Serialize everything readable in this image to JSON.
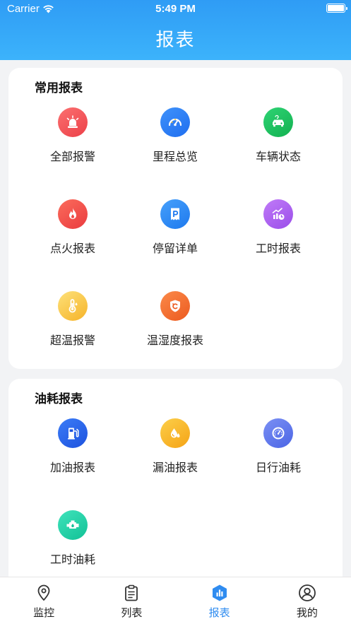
{
  "status_bar": {
    "carrier": "Carrier",
    "time": "5:49 PM"
  },
  "header": {
    "title": "报表"
  },
  "sections": [
    {
      "title": "常用报表",
      "items": [
        {
          "label": "全部报警",
          "icon": "alarm-light-icon",
          "color": "#f2555a"
        },
        {
          "label": "里程总览",
          "icon": "speedometer-icon",
          "color": "#2b7ff6"
        },
        {
          "label": "车辆状态",
          "icon": "car-icon",
          "color": "#19c25f"
        },
        {
          "label": "点火报表",
          "icon": "flame-icon",
          "color": "#f2524f"
        },
        {
          "label": "停留详单",
          "icon": "parking-icon",
          "color": "#2f8cf5"
        },
        {
          "label": "工时报表",
          "icon": "work-hours-chart-icon",
          "color": "#a95ef0"
        },
        {
          "label": "超温报警",
          "icon": "thermometer-icon",
          "color": "#f8c33a"
        },
        {
          "label": "温湿度报表",
          "icon": "temp-humidity-shield-icon",
          "color": "#f26a2e"
        }
      ]
    },
    {
      "title": "油耗报表",
      "items": [
        {
          "label": "加油报表",
          "icon": "fuel-pump-icon",
          "color": "#2f6ef2"
        },
        {
          "label": "漏油报表",
          "icon": "oil-drop-icon",
          "color": "#f8b425"
        },
        {
          "label": "日行油耗",
          "icon": "gauge-icon",
          "color": "#5a78ef"
        },
        {
          "label": "工时油耗",
          "icon": "engine-icon",
          "color": "#1fd1a8"
        }
      ]
    }
  ],
  "tabbar": {
    "tabs": [
      {
        "label": "监控",
        "icon": "location-pin-icon",
        "active": false
      },
      {
        "label": "列表",
        "icon": "clipboard-list-icon",
        "active": false
      },
      {
        "label": "报表",
        "icon": "report-chart-icon",
        "active": true
      },
      {
        "label": "我的",
        "icon": "user-profile-icon",
        "active": false
      }
    ]
  },
  "colors": {
    "header_top": "#2f9cf5",
    "header_bottom": "#3cb3fb",
    "accent": "#2f8cf0",
    "background": "#f2f3f5"
  }
}
